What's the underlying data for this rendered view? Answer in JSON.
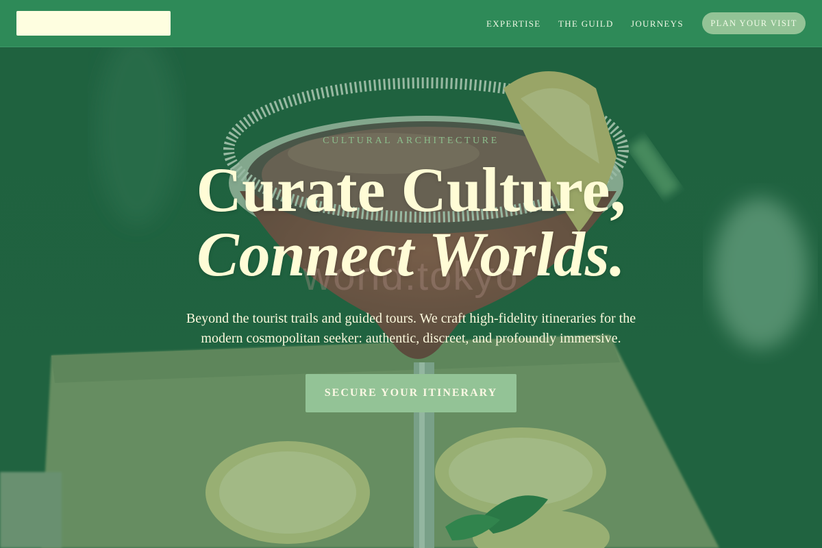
{
  "header": {
    "nav": [
      "EXPERTISE",
      "THE GUILD",
      "JOURNEYS"
    ],
    "cta_label": "PLAN YOUR VISIT"
  },
  "hero": {
    "eyebrow": "CULTURAL ARCHITECTURE",
    "headline_line1": "Curate Culture,",
    "headline_line2": "Connect Worlds.",
    "subtitle": "Beyond the tourist trails and guided tours. We craft high-fidelity itineraries for the modern cosmopolitan seeker: authentic, discreet, and profoundly immersive.",
    "cta_label": "SECURE YOUR ITINERARY",
    "background_watermark": "world.tokyo"
  },
  "colors": {
    "header_bg": "#2e8a58",
    "overlay": "#236a44",
    "accent_button": "#93c396",
    "headline": "#fffcd6",
    "logo_placeholder": "#fefee0"
  }
}
